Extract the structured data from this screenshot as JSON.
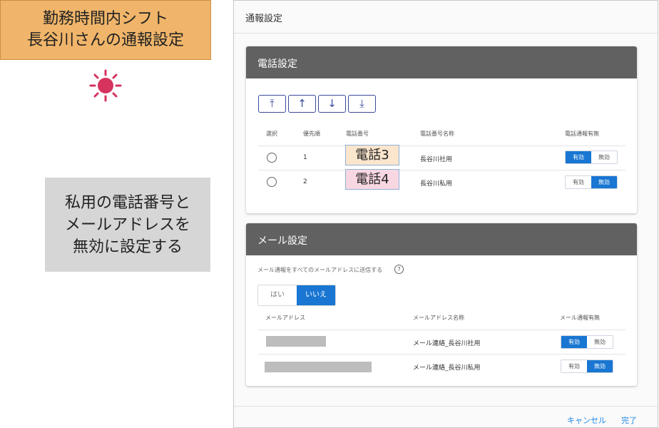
{
  "annotation": {
    "title_line1": "勤務時間内シフト",
    "title_line2": "長谷川さんの通報設定",
    "sun_icon": "sun-icon",
    "note_line1": "私用の電話番号と",
    "note_line2": "メールアドレスを",
    "note_line3": "無効に設定する"
  },
  "dialog": {
    "title": "通報設定",
    "cancel_label": "キャンセル",
    "done_label": "完了"
  },
  "phone": {
    "header": "電話設定",
    "buttons": [
      "⤒",
      "↑",
      "↓",
      "⤓"
    ],
    "columns": [
      "選択",
      "優先順",
      "電話番号",
      "電話番号名称",
      "電話通報有無"
    ],
    "rows": [
      {
        "priority": "1",
        "number": "電話3",
        "name": "長谷川社用",
        "enabled": "有効",
        "disabled": "無効",
        "state": "enabled",
        "label_color": "#fbe5cd"
      },
      {
        "priority": "2",
        "number": "電話4",
        "name": "長谷川私用",
        "enabled": "有効",
        "disabled": "無効",
        "state": "disabled",
        "label_color": "#f8d7e3"
      }
    ]
  },
  "mail": {
    "header": "メール設定",
    "question": "メール通報をすべてのメールアドレスに送信する",
    "help_icon": "?",
    "yes_label": "はい",
    "no_label": "いいえ",
    "selected": "いいえ",
    "columns": [
      "メールアドレス",
      "メールアドレス名称",
      "メール通報有無"
    ],
    "rows": [
      {
        "name": "メール連絡_長谷川社用",
        "enabled": "有効",
        "disabled": "無効",
        "state": "enabled"
      },
      {
        "name": "メール連絡_長谷川私用",
        "enabled": "有効",
        "disabled": "無効",
        "state": "disabled"
      }
    ]
  },
  "colors": {
    "accent": "#1976d2",
    "card_header": "#616161",
    "title_box": "#f0b56a",
    "note_box": "#d6d6d6",
    "sun": "#d6335e"
  }
}
